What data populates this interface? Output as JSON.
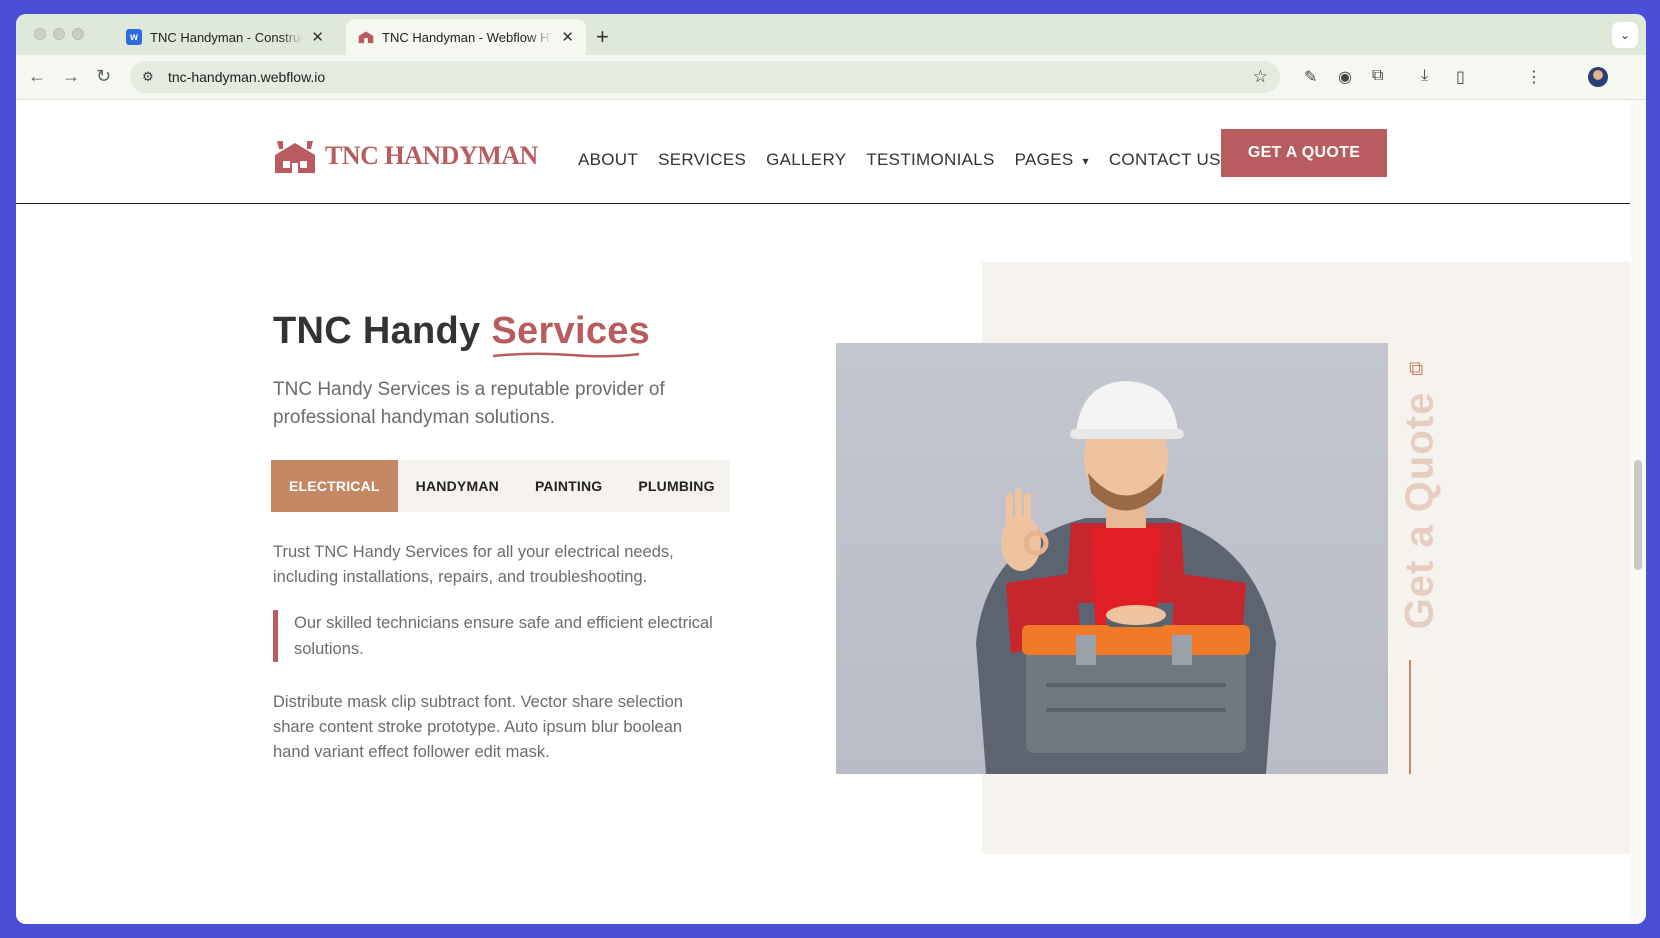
{
  "browser": {
    "tabs": [
      {
        "title": "TNC Handyman - Constructio",
        "favicon": "webflow-icon",
        "active": false
      },
      {
        "title": "TNC Handyman - Webflow HT",
        "favicon": "tnc-logo-icon",
        "active": true
      }
    ],
    "url": "tnc-handyman.webflow.io"
  },
  "site": {
    "logo_text": "TNC HANDYMAN",
    "nav": [
      "ABOUT",
      "SERVICES",
      "GALLERY",
      "TESTIMONIALS",
      "PAGES",
      "CONTACT US"
    ],
    "cta_label": "GET A QUOTE"
  },
  "section": {
    "heading_prefix": "TNC Handy",
    "heading_accent": "Services",
    "subtitle": "TNC Handy Services is a reputable provider of professional handyman solutions.",
    "tabs": [
      "ELECTRICAL",
      "HANDYMAN",
      "PAINTING",
      "PLUMBING"
    ],
    "active_tab": "ELECTRICAL",
    "paragraph1": "Trust TNC Handy Services for all your electrical needs, including installations, repairs, and troubleshooting.",
    "blockquote": "Our skilled technicians ensure safe and efficient electrical solutions.",
    "paragraph2": "Distribute mask clip subtract font. Vector share selection share content stroke prototype. Auto ipsum blur boolean hand variant effect follower edit mask.",
    "side_label": "Get a Quote"
  },
  "colors": {
    "brand": "#b85c5f",
    "tab_active": "#c58865",
    "panel_bg": "#f6f2ee"
  }
}
